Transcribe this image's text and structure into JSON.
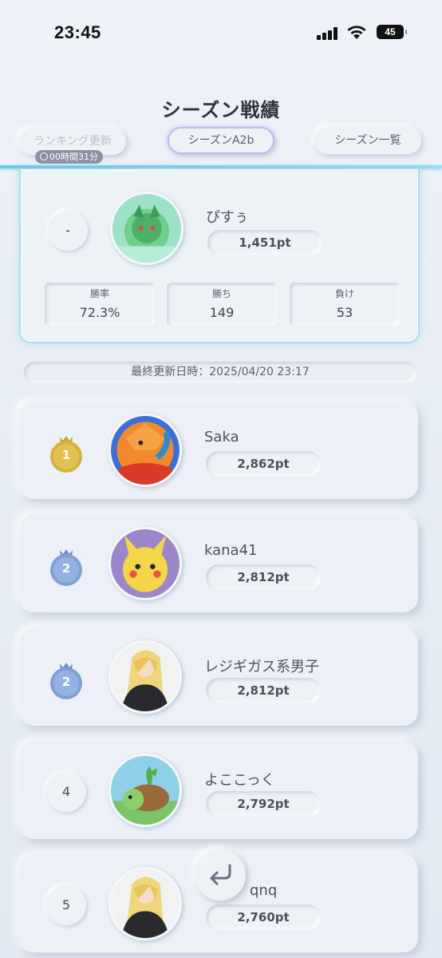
{
  "status_bar": {
    "time": "23:45",
    "battery": "45"
  },
  "header": {
    "title": "シーズン戦績",
    "ranking_update_label": "ランキング更新",
    "timer": "00時間31分",
    "season_label": "シーズンA2b",
    "season_list_label": "シーズン一覧"
  },
  "my_record": {
    "rank": "-",
    "name": "ぴすぅ",
    "points": "1,451pt",
    "stats": [
      {
        "label": "勝率",
        "value": "72.3%"
      },
      {
        "label": "勝ち",
        "value": "149"
      },
      {
        "label": "負け",
        "value": "53"
      }
    ]
  },
  "last_updated": "最終更新日時：2025/04/20 23:17",
  "rankings": [
    {
      "rank": "1",
      "name": "Saka",
      "points": "2,862pt",
      "medal": "gold"
    },
    {
      "rank": "2",
      "name": "kana41",
      "points": "2,812pt",
      "medal": "blue"
    },
    {
      "rank": "2",
      "name": "レジギガス系男子",
      "points": "2,812pt",
      "medal": "blue"
    },
    {
      "rank": "4",
      "name": "よここっく",
      "points": "2,792pt",
      "medal": "none"
    },
    {
      "rank": "5",
      "name": "qnq",
      "points": "2,760pt",
      "medal": "none"
    }
  ],
  "colors": {
    "accent_cyan": "#6cc8e6",
    "season_border": "#c7b7ef",
    "gold": "#d6b23a",
    "blue_medal": "#7f9fd6"
  }
}
